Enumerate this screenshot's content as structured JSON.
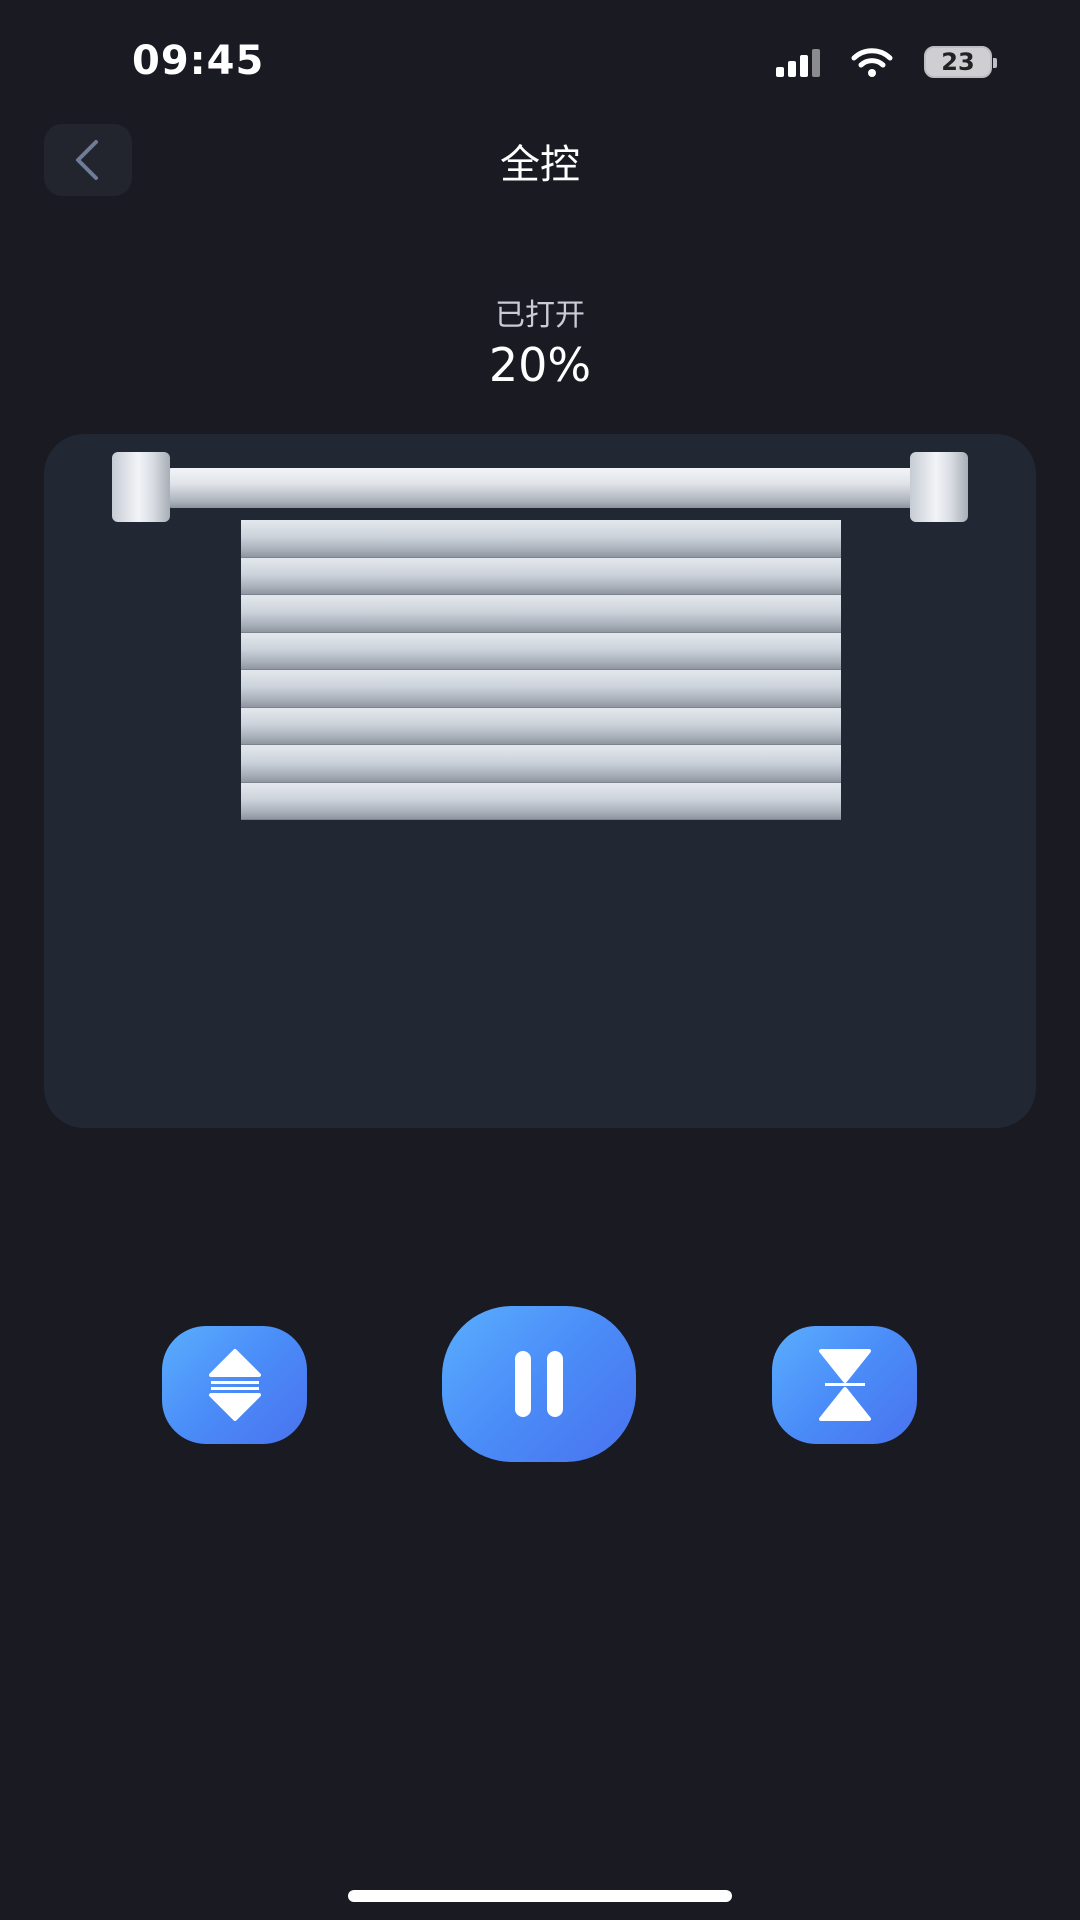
{
  "status_bar": {
    "time": "09:45",
    "battery": "23"
  },
  "header": {
    "title": "全控"
  },
  "curtain": {
    "state_label": "已打开",
    "open_percent": "20%",
    "slat_count": 8
  },
  "controls": {
    "open_icon": "expand-vertical-icon",
    "pause_icon": "pause-icon",
    "close_icon": "collapse-vertical-icon"
  },
  "colors": {
    "background": "#191a22",
    "panel": "#212733",
    "accent": "#4a8cf8"
  }
}
